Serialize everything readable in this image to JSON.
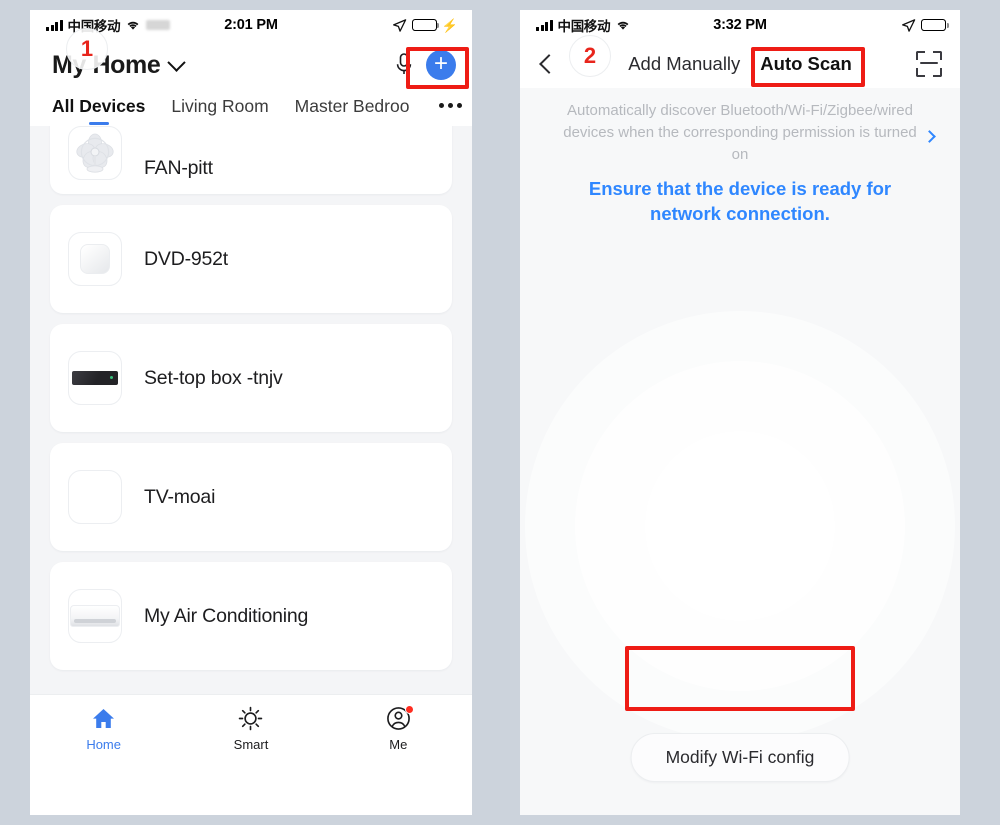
{
  "background_color": "#ccd3dc",
  "accent_color": "#3b7cec",
  "annotation_color": "#ee1c15",
  "left_phone": {
    "status_bar": {
      "carrier": "中国移动",
      "time": "2:01 PM",
      "signal_icon": "cellular-bars-icon",
      "wifi_icon": "wifi-icon",
      "location_icon": "location-arrow-icon",
      "battery_icon": "battery-low-icon",
      "charging_icon": "lightning-bolt-icon"
    },
    "header": {
      "title": "My Home",
      "dropdown_icon": "chevron-down-icon",
      "mic_icon": "microphone-icon",
      "add_label": "+",
      "add_icon": "plus-circle-icon"
    },
    "room_tabs": [
      {
        "label": "All Devices",
        "active": true
      },
      {
        "label": "Living Room",
        "active": false
      },
      {
        "label": "Master Bedroo",
        "active": false
      }
    ],
    "more_tabs_icon": "ellipsis-icon",
    "devices": [
      {
        "name": "FAN-pitt",
        "icon": "fan-icon"
      },
      {
        "name": "DVD-952t",
        "icon": "switch-icon"
      },
      {
        "name": "Set-top box -tnjv",
        "icon": "set-top-box-icon"
      },
      {
        "name": "TV-moai",
        "icon": "television-icon"
      },
      {
        "name": "My Air Conditioning",
        "icon": "air-conditioner-icon"
      }
    ],
    "bottom_nav": [
      {
        "label": "Home",
        "icon": "house-icon",
        "active": true,
        "badge": false
      },
      {
        "label": "Smart",
        "icon": "sun-icon",
        "active": false,
        "badge": false
      },
      {
        "label": "Me",
        "icon": "user-circle-icon",
        "active": false,
        "badge": true
      }
    ]
  },
  "right_phone": {
    "status_bar": {
      "carrier": "中国移动",
      "time": "3:32 PM",
      "signal_icon": "cellular-bars-icon",
      "wifi_icon": "wifi-icon",
      "location_icon": "location-arrow-icon",
      "battery_icon": "battery-full-icon"
    },
    "nav": {
      "back_icon": "chevron-left-icon",
      "tabs": [
        {
          "label": "Add Manually",
          "active": false
        },
        {
          "label": "Auto Scan",
          "active": true
        }
      ],
      "scan_icon": "qr-scan-icon"
    },
    "hint_text": "Automatically discover Bluetooth/Wi-Fi/Zigbee/wired devices when the corresponding permission is turned on",
    "ready_link": "Ensure that the device is ready for network connection.",
    "ready_link_icon": "chevron-right-icon",
    "radar_icon": "radar-scanning-animation",
    "wifi_button": "Modify Wi-Fi config"
  },
  "annotations": {
    "markers": [
      {
        "number": "1",
        "target": "add-device-plus-button"
      },
      {
        "number": "2",
        "target": "auto-scan-tab"
      }
    ],
    "highlights": [
      {
        "target": "add-device-plus-button"
      },
      {
        "target": "auto-scan-tab"
      },
      {
        "target": "modify-wifi-config-button"
      }
    ]
  }
}
